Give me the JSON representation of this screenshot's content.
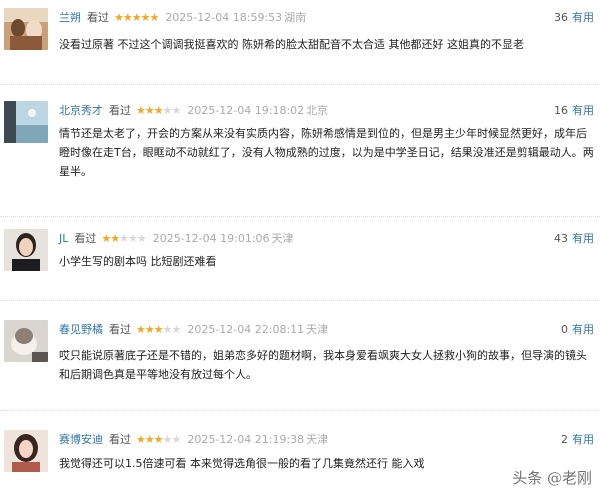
{
  "reviews": [
    {
      "user": "兰朔",
      "verb": "看过",
      "rating": 5,
      "time": "2025-12-04 18:59:53",
      "location": "湖南",
      "useful_count": "36",
      "useful_label": "有用",
      "text": "没看过原著 不过这个调调我挺喜欢的 陈妍希的脸太甜配音不太合适 其他都还好 这姐真的不显老"
    },
    {
      "user": "北京秀才",
      "verb": "看过",
      "rating": 3,
      "time": "2025-12-04 19:18:02",
      "location": "北京",
      "useful_count": "16",
      "useful_label": "有用",
      "text": "情节还是太老了，开会的方案从来没有实质内容，陈妍希感情是到位的，但是男主少年时候显然更好，成年后瞪时像在走T台，眼眶动不动就红了，没有人物成熟的过度，以为是中学圣日记，结果没准还是剪辑最动人。两星半。"
    },
    {
      "user": "JL",
      "verb": "看过",
      "rating": 2,
      "time": "2025-12-04 19:01:06",
      "location": "天津",
      "useful_count": "43",
      "useful_label": "有用",
      "text": "小学生写的剧本吗 比短剧还难看"
    },
    {
      "user": "春见野橘",
      "verb": "看过",
      "rating": 3,
      "time": "2025-12-04 22:08:11",
      "location": "天津",
      "useful_count": "0",
      "useful_label": "有用",
      "text": "哎只能说原著底子还是不错的，姐弟恋多好的题材啊，我本身爱看飒爽大女人拯救小狗的故事，但导演的镜头和后期调色真是平等地没有放过每个人。"
    },
    {
      "user": "赛博安迪",
      "verb": "看过",
      "rating": 3,
      "time": "2025-12-04 21:19:38",
      "location": "天津",
      "useful_count": "2",
      "useful_label": "有用",
      "text": "我觉得还可以1.5倍速可看 本来觉得选角很一般的看了几集竟然还行 能入戏"
    }
  ],
  "watermark": "头条 @老刚",
  "colors": {
    "link": "#3377aa",
    "star": "#f5a623",
    "star_off": "#d8d8d8",
    "muted": "#aaaaaa"
  }
}
